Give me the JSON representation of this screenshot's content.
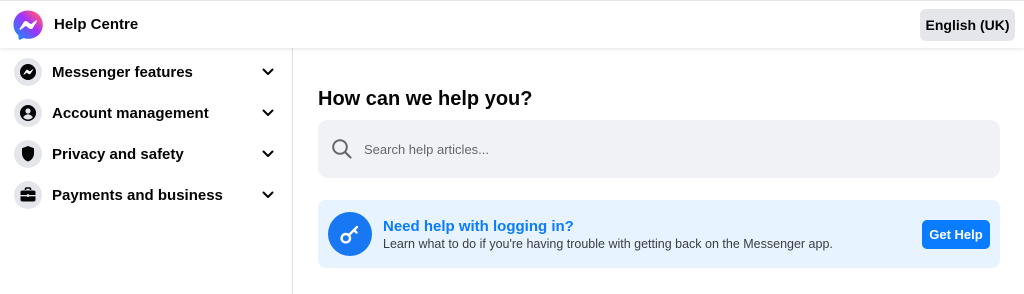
{
  "header": {
    "title": "Help Centre",
    "language_button": "English (UK)",
    "logo_icon": "messenger-logo-icon"
  },
  "sidebar": {
    "items": [
      {
        "label": "Messenger features",
        "icon": "messenger-bolt-icon"
      },
      {
        "label": "Account management",
        "icon": "person-icon"
      },
      {
        "label": "Privacy and safety",
        "icon": "shield-icon"
      },
      {
        "label": "Payments and business",
        "icon": "briefcase-icon"
      }
    ]
  },
  "main": {
    "title": "How can we help you?",
    "search": {
      "placeholder": "Search help articles...",
      "value": ""
    },
    "banner": {
      "title": "Need help with logging in?",
      "description": "Learn what to do if you're having trouble with getting back on the Messenger app.",
      "button_label": "Get Help",
      "icon": "key-icon"
    }
  },
  "colors": {
    "accent": "#0a7cff",
    "banner_bg": "#e7f3ff",
    "search_bg": "#f0f2f5",
    "chip_bg": "#e4e6eb"
  }
}
